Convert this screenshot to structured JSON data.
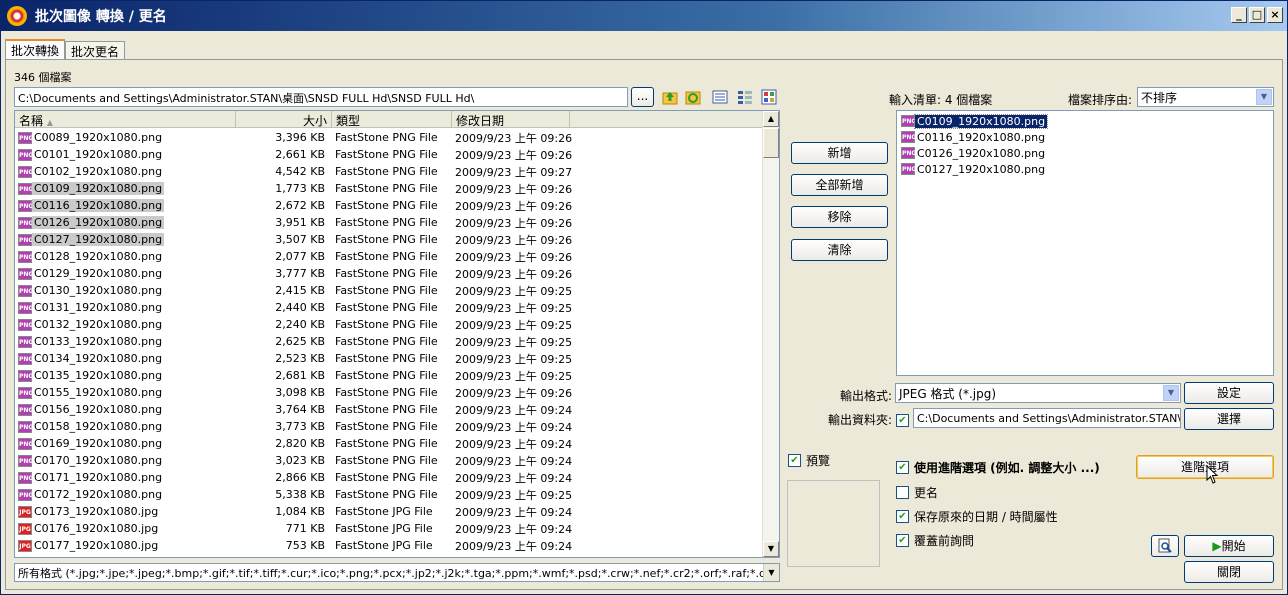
{
  "window": {
    "title": "批次圖像 轉換 / 更名",
    "controls": [
      "_",
      "□",
      "×"
    ]
  },
  "tabs": [
    {
      "label": "批次轉換",
      "active": true
    },
    {
      "label": "批次更名",
      "active": false
    }
  ],
  "file_count": "346 個檔案",
  "path": "C:\\Documents and Settings\\Administrator.STAN\\桌面\\SNSD  FULL Hd\\SNSD  FULL Hd\\",
  "browse_label": "...",
  "toolbar_icons": [
    "folder-up-icon",
    "refresh-icon",
    "details-view-icon",
    "list-view-icon",
    "thumbnail-view-icon"
  ],
  "file_list": {
    "columns": [
      "名稱",
      "大小",
      "類型",
      "修改日期"
    ],
    "rows": [
      {
        "icon": "png",
        "name": "C0089_1920x1080.png",
        "size": "3,396 KB",
        "type": "FastStone PNG File",
        "date": "2009/9/23 上午 09:26",
        "selected": false
      },
      {
        "icon": "png",
        "name": "C0101_1920x1080.png",
        "size": "2,661 KB",
        "type": "FastStone PNG File",
        "date": "2009/9/23 上午 09:26",
        "selected": false
      },
      {
        "icon": "png",
        "name": "C0102_1920x1080.png",
        "size": "4,542 KB",
        "type": "FastStone PNG File",
        "date": "2009/9/23 上午 09:27",
        "selected": false
      },
      {
        "icon": "png",
        "name": "C0109_1920x1080.png",
        "size": "1,773 KB",
        "type": "FastStone PNG File",
        "date": "2009/9/23 上午 09:26",
        "selected": true
      },
      {
        "icon": "png",
        "name": "C0116_1920x1080.png",
        "size": "2,672 KB",
        "type": "FastStone PNG File",
        "date": "2009/9/23 上午 09:26",
        "selected": true
      },
      {
        "icon": "png",
        "name": "C0126_1920x1080.png",
        "size": "3,951 KB",
        "type": "FastStone PNG File",
        "date": "2009/9/23 上午 09:26",
        "selected": true
      },
      {
        "icon": "png",
        "name": "C0127_1920x1080.png",
        "size": "3,507 KB",
        "type": "FastStone PNG File",
        "date": "2009/9/23 上午 09:26",
        "selected": true
      },
      {
        "icon": "png",
        "name": "C0128_1920x1080.png",
        "size": "2,077 KB",
        "type": "FastStone PNG File",
        "date": "2009/9/23 上午 09:26",
        "selected": false
      },
      {
        "icon": "png",
        "name": "C0129_1920x1080.png",
        "size": "3,777 KB",
        "type": "FastStone PNG File",
        "date": "2009/9/23 上午 09:26",
        "selected": false
      },
      {
        "icon": "png",
        "name": "C0130_1920x1080.png",
        "size": "2,415 KB",
        "type": "FastStone PNG File",
        "date": "2009/9/23 上午 09:25",
        "selected": false
      },
      {
        "icon": "png",
        "name": "C0131_1920x1080.png",
        "size": "2,440 KB",
        "type": "FastStone PNG File",
        "date": "2009/9/23 上午 09:25",
        "selected": false
      },
      {
        "icon": "png",
        "name": "C0132_1920x1080.png",
        "size": "2,240 KB",
        "type": "FastStone PNG File",
        "date": "2009/9/23 上午 09:25",
        "selected": false
      },
      {
        "icon": "png",
        "name": "C0133_1920x1080.png",
        "size": "2,625 KB",
        "type": "FastStone PNG File",
        "date": "2009/9/23 上午 09:25",
        "selected": false
      },
      {
        "icon": "png",
        "name": "C0134_1920x1080.png",
        "size": "2,523 KB",
        "type": "FastStone PNG File",
        "date": "2009/9/23 上午 09:25",
        "selected": false
      },
      {
        "icon": "png",
        "name": "C0135_1920x1080.png",
        "size": "2,681 KB",
        "type": "FastStone PNG File",
        "date": "2009/9/23 上午 09:25",
        "selected": false
      },
      {
        "icon": "png",
        "name": "C0155_1920x1080.png",
        "size": "3,098 KB",
        "type": "FastStone PNG File",
        "date": "2009/9/23 上午 09:26",
        "selected": false
      },
      {
        "icon": "png",
        "name": "C0156_1920x1080.png",
        "size": "3,764 KB",
        "type": "FastStone PNG File",
        "date": "2009/9/23 上午 09:24",
        "selected": false
      },
      {
        "icon": "png",
        "name": "C0158_1920x1080.png",
        "size": "3,773 KB",
        "type": "FastStone PNG File",
        "date": "2009/9/23 上午 09:24",
        "selected": false
      },
      {
        "icon": "png",
        "name": "C0169_1920x1080.png",
        "size": "2,820 KB",
        "type": "FastStone PNG File",
        "date": "2009/9/23 上午 09:24",
        "selected": false
      },
      {
        "icon": "png",
        "name": "C0170_1920x1080.png",
        "size": "3,023 KB",
        "type": "FastStone PNG File",
        "date": "2009/9/23 上午 09:24",
        "selected": false
      },
      {
        "icon": "png",
        "name": "C0171_1920x1080.png",
        "size": "2,866 KB",
        "type": "FastStone PNG File",
        "date": "2009/9/23 上午 09:24",
        "selected": false
      },
      {
        "icon": "png",
        "name": "C0172_1920x1080.png",
        "size": "5,338 KB",
        "type": "FastStone PNG File",
        "date": "2009/9/23 上午 09:25",
        "selected": false
      },
      {
        "icon": "jpg",
        "name": "C0173_1920x1080.jpg",
        "size": "1,084 KB",
        "type": "FastStone JPG File",
        "date": "2009/9/23 上午 09:24",
        "selected": false
      },
      {
        "icon": "jpg",
        "name": "C0176_1920x1080.jpg",
        "size": "771 KB",
        "type": "FastStone JPG File",
        "date": "2009/9/23 上午 09:24",
        "selected": false
      },
      {
        "icon": "jpg",
        "name": "C0177_1920x1080.jpg",
        "size": "753 KB",
        "type": "FastStone JPG File",
        "date": "2009/9/23 上午 09:24",
        "selected": false
      }
    ]
  },
  "filter": "所有格式 (*.jpg;*.jpe;*.jpeg;*.bmp;*.gif;*.tif;*.tiff;*.cur;*.ico;*.png;*.pcx;*.jp2;*.j2k;*.tga;*.ppm;*.wmf;*.psd;*.crw;*.nef;*.cr2;*.orf;*.raf;*.dng;*",
  "actions": {
    "add": "新增",
    "add_all": "全部新增",
    "remove": "移除",
    "clear": "清除"
  },
  "input_list": {
    "label": "輸入清單: 4 個檔案",
    "sort_label": "檔案排序由:",
    "sort_value": "不排序",
    "items": [
      {
        "name": "C0109_1920x1080.png",
        "selected": true
      },
      {
        "name": "C0116_1920x1080.png",
        "selected": false
      },
      {
        "name": "C0126_1920x1080.png",
        "selected": false
      },
      {
        "name": "C0127_1920x1080.png",
        "selected": false
      }
    ]
  },
  "output": {
    "format_label": "輸出格式:",
    "format_value": "JPEG 格式 (*.jpg)",
    "settings_button": "設定",
    "folder_label": "輸出資料夾:",
    "folder_value": "C:\\Documents and Settings\\Administrator.STAN\\桌面",
    "browse_button": "選擇"
  },
  "preview_label": "預覽",
  "options": {
    "advanced_label": "使用進階選項 (例如. 調整大小 ...)",
    "advanced_button": "進階選項",
    "rename_label": "更名",
    "keep_date_label": "保存原來的日期 / 時間屬性",
    "overwrite_label": "覆蓋前詢問"
  },
  "buttons": {
    "start": "開始",
    "close": "關閉"
  }
}
